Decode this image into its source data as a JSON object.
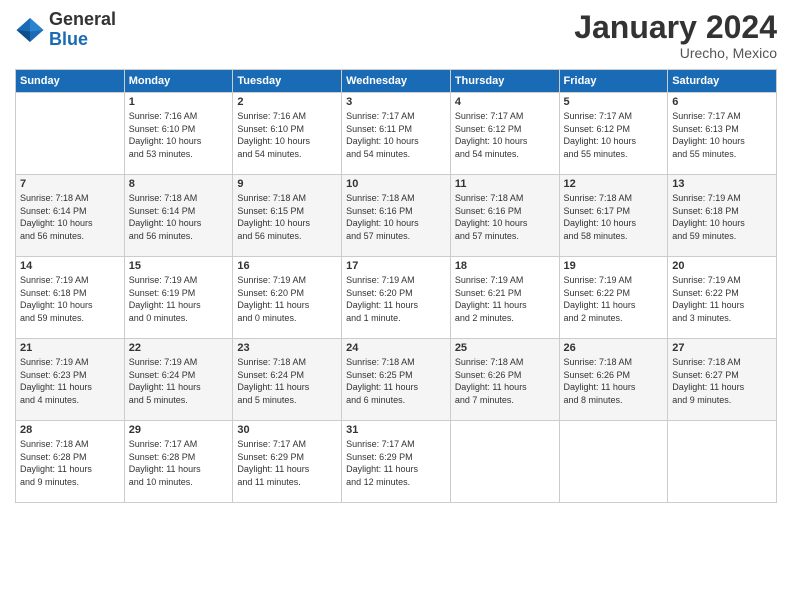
{
  "header": {
    "logo_general": "General",
    "logo_blue": "Blue",
    "title": "January 2024",
    "location": "Urecho, Mexico"
  },
  "weekdays": [
    "Sunday",
    "Monday",
    "Tuesday",
    "Wednesday",
    "Thursday",
    "Friday",
    "Saturday"
  ],
  "weeks": [
    [
      {
        "num": "",
        "info": ""
      },
      {
        "num": "1",
        "info": "Sunrise: 7:16 AM\nSunset: 6:10 PM\nDaylight: 10 hours\nand 53 minutes."
      },
      {
        "num": "2",
        "info": "Sunrise: 7:16 AM\nSunset: 6:10 PM\nDaylight: 10 hours\nand 54 minutes."
      },
      {
        "num": "3",
        "info": "Sunrise: 7:17 AM\nSunset: 6:11 PM\nDaylight: 10 hours\nand 54 minutes."
      },
      {
        "num": "4",
        "info": "Sunrise: 7:17 AM\nSunset: 6:12 PM\nDaylight: 10 hours\nand 54 minutes."
      },
      {
        "num": "5",
        "info": "Sunrise: 7:17 AM\nSunset: 6:12 PM\nDaylight: 10 hours\nand 55 minutes."
      },
      {
        "num": "6",
        "info": "Sunrise: 7:17 AM\nSunset: 6:13 PM\nDaylight: 10 hours\nand 55 minutes."
      }
    ],
    [
      {
        "num": "7",
        "info": "Sunrise: 7:18 AM\nSunset: 6:14 PM\nDaylight: 10 hours\nand 56 minutes."
      },
      {
        "num": "8",
        "info": "Sunrise: 7:18 AM\nSunset: 6:14 PM\nDaylight: 10 hours\nand 56 minutes."
      },
      {
        "num": "9",
        "info": "Sunrise: 7:18 AM\nSunset: 6:15 PM\nDaylight: 10 hours\nand 56 minutes."
      },
      {
        "num": "10",
        "info": "Sunrise: 7:18 AM\nSunset: 6:16 PM\nDaylight: 10 hours\nand 57 minutes."
      },
      {
        "num": "11",
        "info": "Sunrise: 7:18 AM\nSunset: 6:16 PM\nDaylight: 10 hours\nand 57 minutes."
      },
      {
        "num": "12",
        "info": "Sunrise: 7:18 AM\nSunset: 6:17 PM\nDaylight: 10 hours\nand 58 minutes."
      },
      {
        "num": "13",
        "info": "Sunrise: 7:19 AM\nSunset: 6:18 PM\nDaylight: 10 hours\nand 59 minutes."
      }
    ],
    [
      {
        "num": "14",
        "info": "Sunrise: 7:19 AM\nSunset: 6:18 PM\nDaylight: 10 hours\nand 59 minutes."
      },
      {
        "num": "15",
        "info": "Sunrise: 7:19 AM\nSunset: 6:19 PM\nDaylight: 11 hours\nand 0 minutes."
      },
      {
        "num": "16",
        "info": "Sunrise: 7:19 AM\nSunset: 6:20 PM\nDaylight: 11 hours\nand 0 minutes."
      },
      {
        "num": "17",
        "info": "Sunrise: 7:19 AM\nSunset: 6:20 PM\nDaylight: 11 hours\nand 1 minute."
      },
      {
        "num": "18",
        "info": "Sunrise: 7:19 AM\nSunset: 6:21 PM\nDaylight: 11 hours\nand 2 minutes."
      },
      {
        "num": "19",
        "info": "Sunrise: 7:19 AM\nSunset: 6:22 PM\nDaylight: 11 hours\nand 2 minutes."
      },
      {
        "num": "20",
        "info": "Sunrise: 7:19 AM\nSunset: 6:22 PM\nDaylight: 11 hours\nand 3 minutes."
      }
    ],
    [
      {
        "num": "21",
        "info": "Sunrise: 7:19 AM\nSunset: 6:23 PM\nDaylight: 11 hours\nand 4 minutes."
      },
      {
        "num": "22",
        "info": "Sunrise: 7:19 AM\nSunset: 6:24 PM\nDaylight: 11 hours\nand 5 minutes."
      },
      {
        "num": "23",
        "info": "Sunrise: 7:18 AM\nSunset: 6:24 PM\nDaylight: 11 hours\nand 5 minutes."
      },
      {
        "num": "24",
        "info": "Sunrise: 7:18 AM\nSunset: 6:25 PM\nDaylight: 11 hours\nand 6 minutes."
      },
      {
        "num": "25",
        "info": "Sunrise: 7:18 AM\nSunset: 6:26 PM\nDaylight: 11 hours\nand 7 minutes."
      },
      {
        "num": "26",
        "info": "Sunrise: 7:18 AM\nSunset: 6:26 PM\nDaylight: 11 hours\nand 8 minutes."
      },
      {
        "num": "27",
        "info": "Sunrise: 7:18 AM\nSunset: 6:27 PM\nDaylight: 11 hours\nand 9 minutes."
      }
    ],
    [
      {
        "num": "28",
        "info": "Sunrise: 7:18 AM\nSunset: 6:28 PM\nDaylight: 11 hours\nand 9 minutes."
      },
      {
        "num": "29",
        "info": "Sunrise: 7:17 AM\nSunset: 6:28 PM\nDaylight: 11 hours\nand 10 minutes."
      },
      {
        "num": "30",
        "info": "Sunrise: 7:17 AM\nSunset: 6:29 PM\nDaylight: 11 hours\nand 11 minutes."
      },
      {
        "num": "31",
        "info": "Sunrise: 7:17 AM\nSunset: 6:29 PM\nDaylight: 11 hours\nand 12 minutes."
      },
      {
        "num": "",
        "info": ""
      },
      {
        "num": "",
        "info": ""
      },
      {
        "num": "",
        "info": ""
      }
    ]
  ]
}
